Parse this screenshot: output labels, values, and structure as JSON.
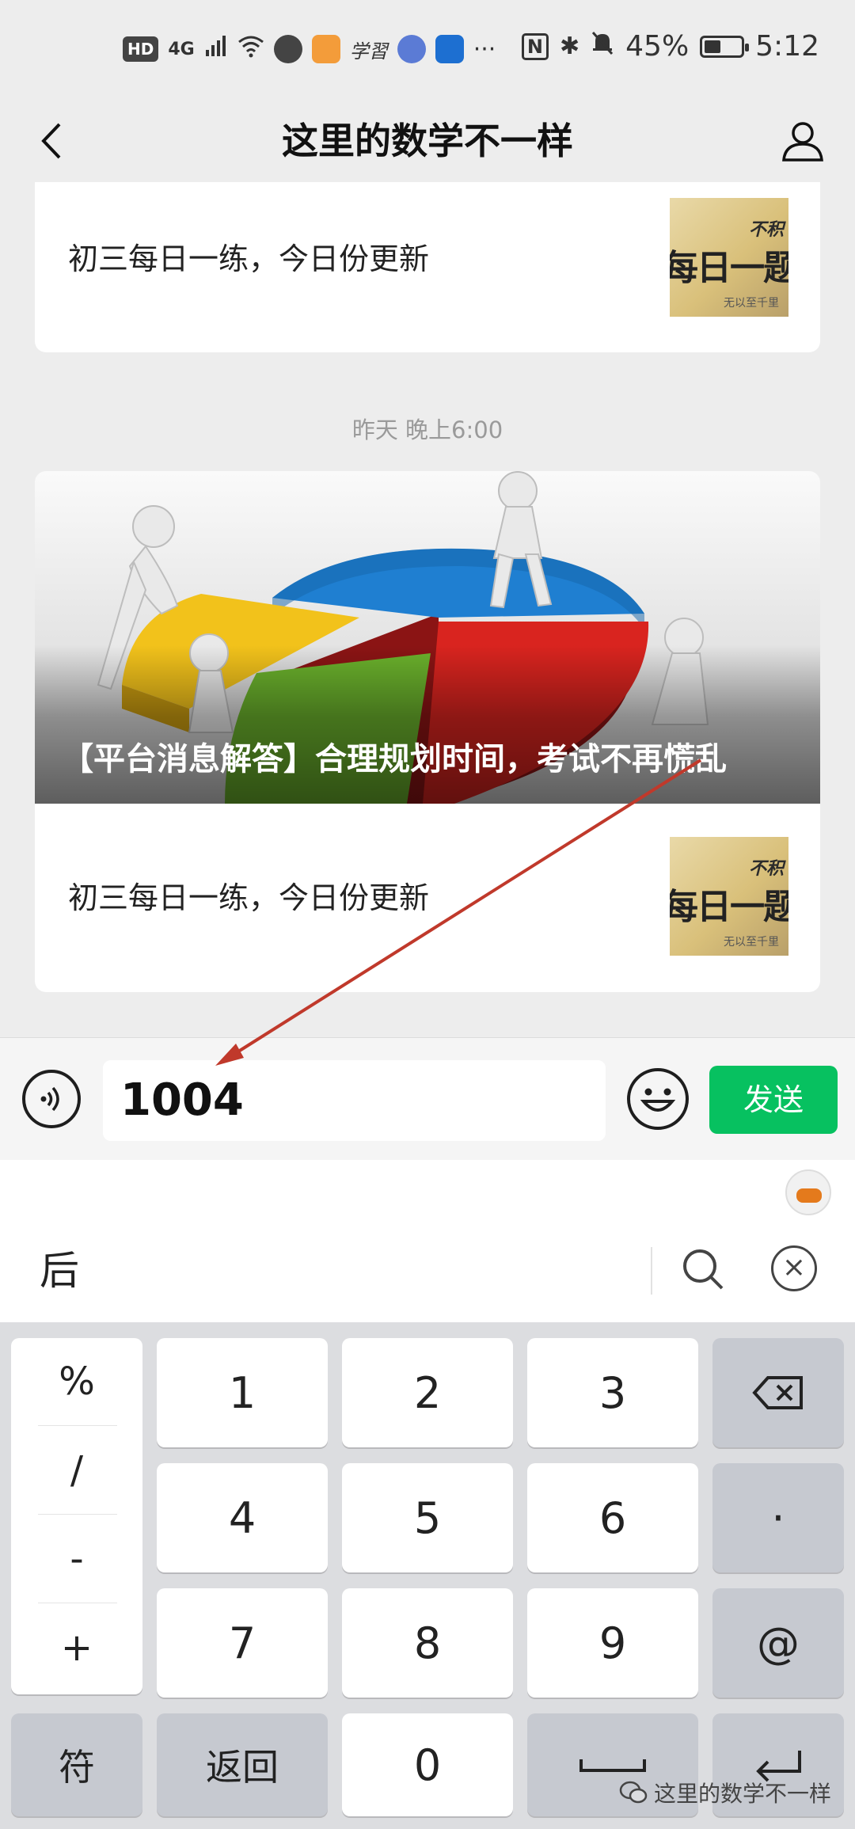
{
  "status_bar": {
    "badge": "HD",
    "network": "4G",
    "app_label": "学習",
    "more": "···",
    "nfc": "N",
    "bluetooth": "✱",
    "battery": "45%",
    "battery_level": 0.45,
    "time": "5:12"
  },
  "header": {
    "title": "这里的数学不一样"
  },
  "messages": {
    "card1_text": "初三每日一练，今日份更新",
    "timestamp": "昨天 晚上6:00",
    "hero_title": "【平台消息解答】合理规划时间，考试不再慌乱",
    "card2_text": "初三每日一练，今日份更新",
    "thumb": {
      "line1": "不积",
      "line2": "每日一题",
      "line3": "无以至千里"
    }
  },
  "input_bar": {
    "value": "1004",
    "send_label": "发送"
  },
  "ime": {
    "candidate": "后",
    "clear": "×"
  },
  "keyboard": {
    "symbols": [
      "%",
      "/",
      "-",
      "+"
    ],
    "digits": [
      "1",
      "2",
      "3",
      "4",
      "5",
      "6",
      "7",
      "8",
      "9",
      "0"
    ],
    "dot": "·",
    "at": "@",
    "sym_key": "符",
    "back_key": "返回"
  },
  "watermark": "这里的数学不一样",
  "colors": {
    "send_green": "#07c160",
    "arrow_red": "#c0392b",
    "background": "#ededed"
  }
}
